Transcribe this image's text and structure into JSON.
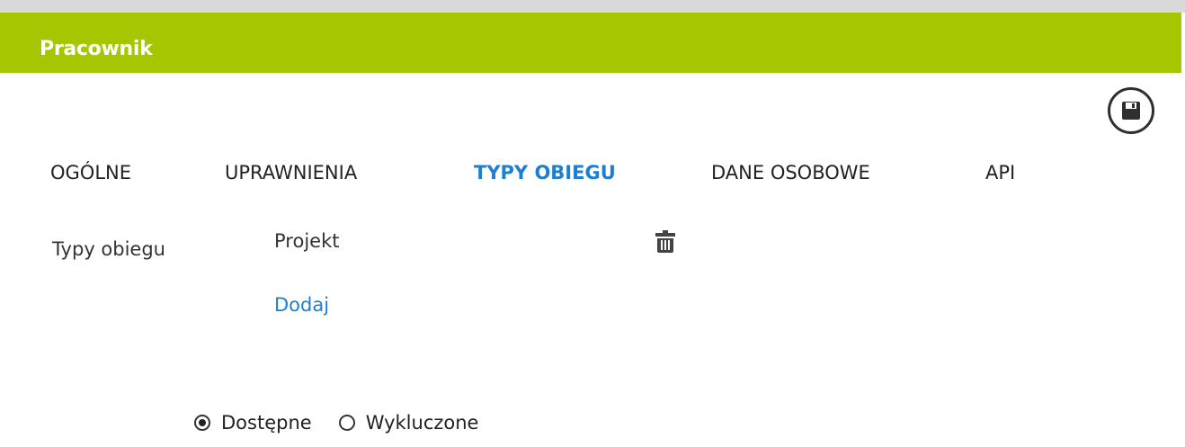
{
  "header": {
    "title": "Pracownik",
    "background_color": "#a5c600"
  },
  "toolbar": {
    "save_icon": "floppy-disk-icon"
  },
  "tabs": [
    {
      "label": "OGÓLNE",
      "active": false
    },
    {
      "label": "UPRAWNIENIA",
      "active": false
    },
    {
      "label": "TYPY OBIEGU",
      "active": true
    },
    {
      "label": "DANE OSOBOWE",
      "active": false
    },
    {
      "label": "API",
      "active": false
    }
  ],
  "accent_color": "#1e7fd0",
  "form": {
    "label": "Typy obiegu",
    "items": [
      {
        "name": "Projekt",
        "action_icon": "trash-icon"
      }
    ],
    "add_link": "Dodaj"
  },
  "filter": {
    "options": [
      {
        "label": "Dostępne",
        "selected": true
      },
      {
        "label": "Wykluczone",
        "selected": false
      }
    ]
  }
}
